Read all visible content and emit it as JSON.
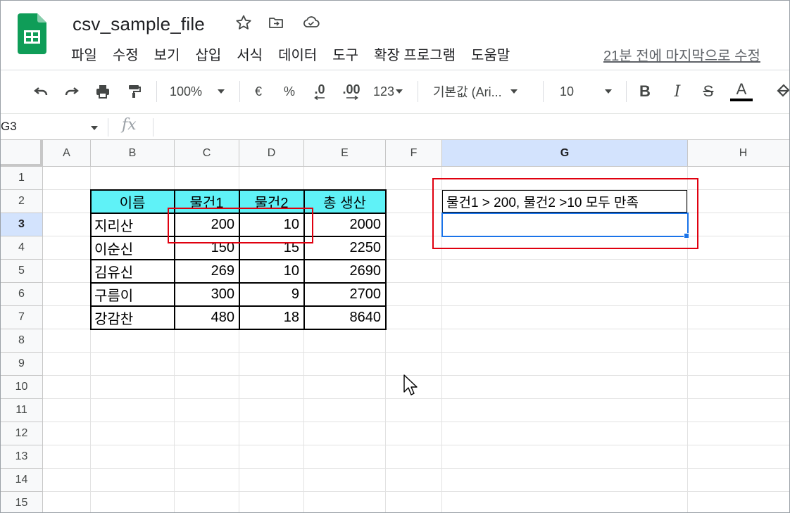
{
  "app": {
    "doc_title": "csv_sample_file",
    "last_edit": "21분 전에 마지막으로 수정",
    "menu": [
      "파일",
      "수정",
      "보기",
      "삽입",
      "서식",
      "데이터",
      "도구",
      "확장 프로그램",
      "도움말"
    ]
  },
  "toolbar": {
    "zoom": "100%",
    "currency": "€",
    "percent": "%",
    "dec_decrease": ".0",
    "dec_increase": ".00",
    "format_more": "123",
    "font": "기본값 (Ari...",
    "font_size": "10",
    "bold": "B",
    "italic": "I",
    "strike": "S",
    "text_color": "A"
  },
  "formula_bar": {
    "name_box": "G3",
    "fx": "fx",
    "content": ""
  },
  "grid": {
    "columns": [
      "A",
      "B",
      "C",
      "D",
      "E",
      "F",
      "G",
      "H"
    ],
    "rows": [
      "1",
      "2",
      "3",
      "4",
      "5",
      "6",
      "7",
      "8",
      "9",
      "10",
      "11",
      "12",
      "13",
      "14",
      "15"
    ],
    "active_cell": "G3"
  },
  "table": {
    "headers": [
      "이름",
      "물건1",
      "물건2",
      "총 생산"
    ],
    "rows": [
      [
        "지리산",
        "200",
        "10",
        "2000"
      ],
      [
        "이순신",
        "150",
        "15",
        "2250"
      ],
      [
        "김유신",
        "269",
        "10",
        "2690"
      ],
      [
        "구름이",
        "300",
        "9",
        "2700"
      ],
      [
        "강감찬",
        "480",
        "18",
        "8640"
      ]
    ]
  },
  "g2_text": "물건1 > 200, 물건2 >10 모두 만족",
  "colors": {
    "header_fill": "#5ff2f7",
    "selection": "#1a73e8",
    "annotation": "#e0000f",
    "logo_green": "#0f9d58"
  }
}
